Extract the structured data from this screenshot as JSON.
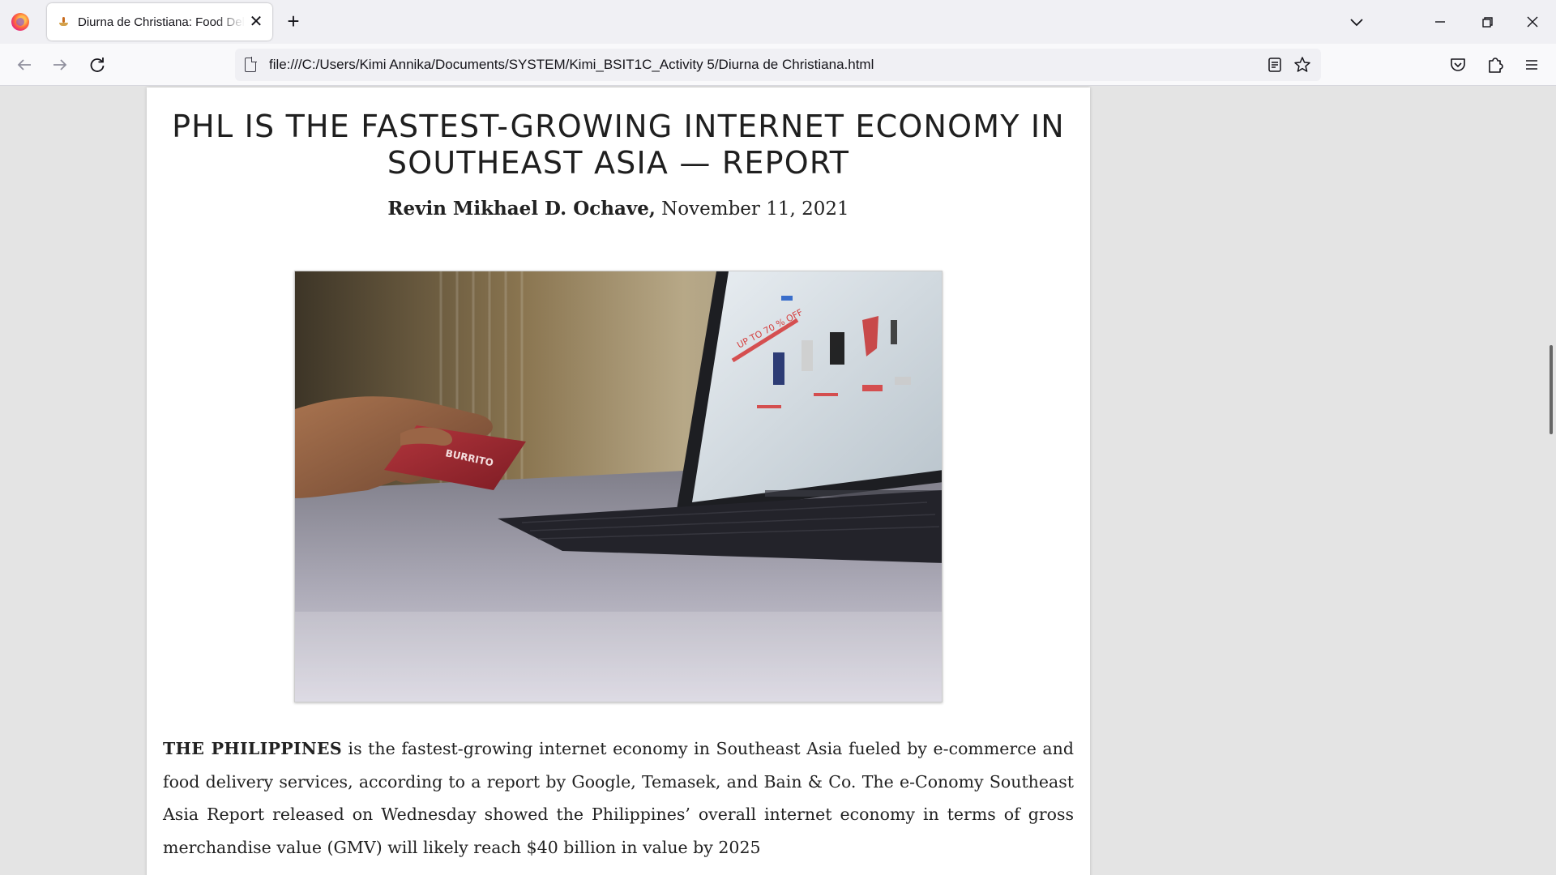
{
  "browser": {
    "tab": {
      "title": "Diurna de Christiana: Food Deli"
    },
    "url": "file:///C:/Users/Kimi Annika/Documents/SYSTEM/Kimi_BSIT1C_Activity 5/Diurna de Christiana.html",
    "icons": {
      "back": "←",
      "forward": "→",
      "reload": "↻",
      "new_tab": "+",
      "close_tab": "✕",
      "tab_list": "⌄",
      "minimize": "—",
      "restore": "❐",
      "close_window": "✕",
      "reader_view": "▤",
      "bookmark": "☆",
      "pocket": "♡",
      "extensions": "⧉",
      "menu": "≡"
    }
  },
  "article": {
    "headline": "PHL IS THE FASTEST-GROWING INTERNET ECONOMY IN SOUTHEAST ASIA — REPORT",
    "author": "Revin Mikhael D. Ochave,",
    "date": " November 11, 2021",
    "image": {
      "card_text": "BURRITO",
      "banner_text": "UP TO 70 % OFF"
    },
    "lead": "THE PHILIPPINES",
    "body": " is the fastest-growing internet economy in Southeast Asia fueled by e-commerce and food delivery services, according to a report by Google, Temasek, and Bain & Co. The e-Conomy Southeast Asia Report released on Wednesday showed the Philippines’ overall internet economy in terms of gross merchandise value (GMV) will likely reach $40 billion in value by 2025"
  }
}
